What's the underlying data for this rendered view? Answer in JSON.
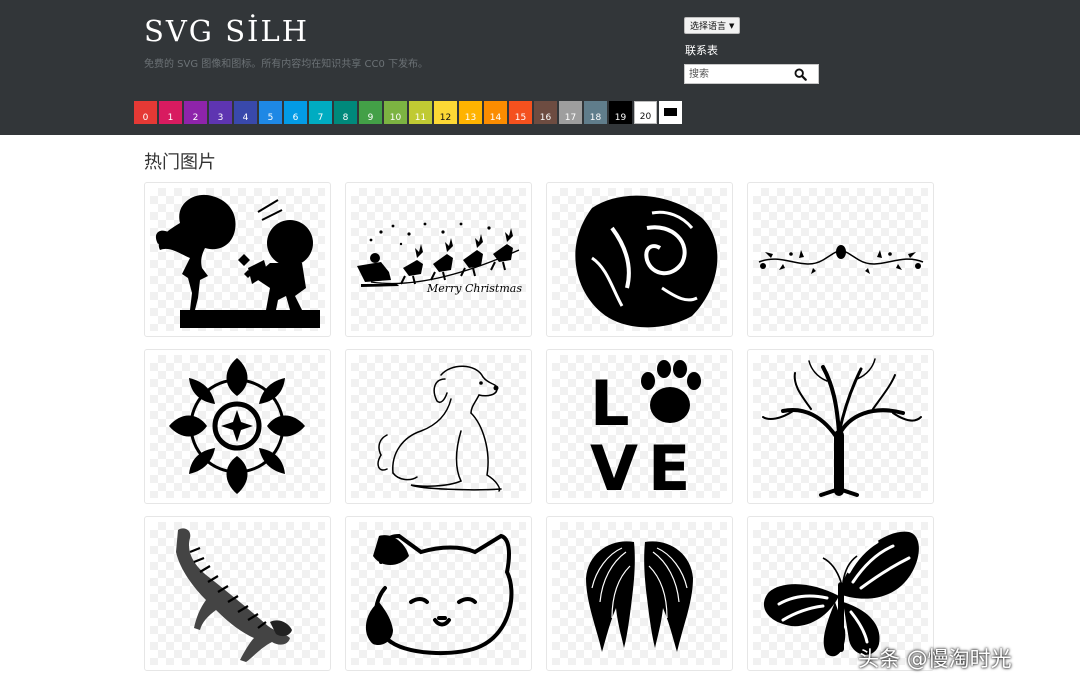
{
  "header": {
    "brand": "SVG SİLH",
    "tagline": "免费的 SVG 图像和图标。所有内容均在知识共享 CC0 下发布。",
    "language_button": "选择语言",
    "contact_link": "联系表",
    "search": {
      "placeholder": "搜索"
    }
  },
  "color_filters": [
    {
      "label": "0",
      "color": "#e53935"
    },
    {
      "label": "1",
      "color": "#d81b60"
    },
    {
      "label": "2",
      "color": "#8e24aa"
    },
    {
      "label": "3",
      "color": "#5e35b1"
    },
    {
      "label": "4",
      "color": "#3949ab"
    },
    {
      "label": "5",
      "color": "#1e88e5"
    },
    {
      "label": "6",
      "color": "#039be5"
    },
    {
      "label": "7",
      "color": "#00acc1"
    },
    {
      "label": "8",
      "color": "#00897b"
    },
    {
      "label": "9",
      "color": "#43a047"
    },
    {
      "label": "10",
      "color": "#7cb342"
    },
    {
      "label": "11",
      "color": "#c0ca33"
    },
    {
      "label": "12",
      "color": "#fdd835"
    },
    {
      "label": "13",
      "color": "#ffb300"
    },
    {
      "label": "14",
      "color": "#fb8c00"
    },
    {
      "label": "15",
      "color": "#f4511e"
    },
    {
      "label": "16",
      "color": "#6d4c41"
    },
    {
      "label": "17",
      "color": "#9e9e9e"
    },
    {
      "label": "18",
      "color": "#607d8b"
    },
    {
      "label": "19",
      "color": "#000000"
    },
    {
      "label": "20",
      "color": "#ffffff"
    }
  ],
  "section_title": "热门图片",
  "gallery": [
    {
      "icon": "couple-silhouette-icon"
    },
    {
      "icon": "santa-sleigh-icon",
      "caption": "Merry Christmas"
    },
    {
      "icon": "rose-icon"
    },
    {
      "icon": "floral-divider-icon"
    },
    {
      "icon": "mandala-icon"
    },
    {
      "icon": "puppy-line-art-icon"
    },
    {
      "icon": "love-paw-icon",
      "letters": [
        "L",
        "V",
        "E"
      ]
    },
    {
      "icon": "bare-tree-icon"
    },
    {
      "icon": "tiger-icon"
    },
    {
      "icon": "lucky-cat-icon"
    },
    {
      "icon": "angel-wings-icon"
    },
    {
      "icon": "butterfly-icon"
    }
  ],
  "watermark": "头条 @慢淘时光"
}
